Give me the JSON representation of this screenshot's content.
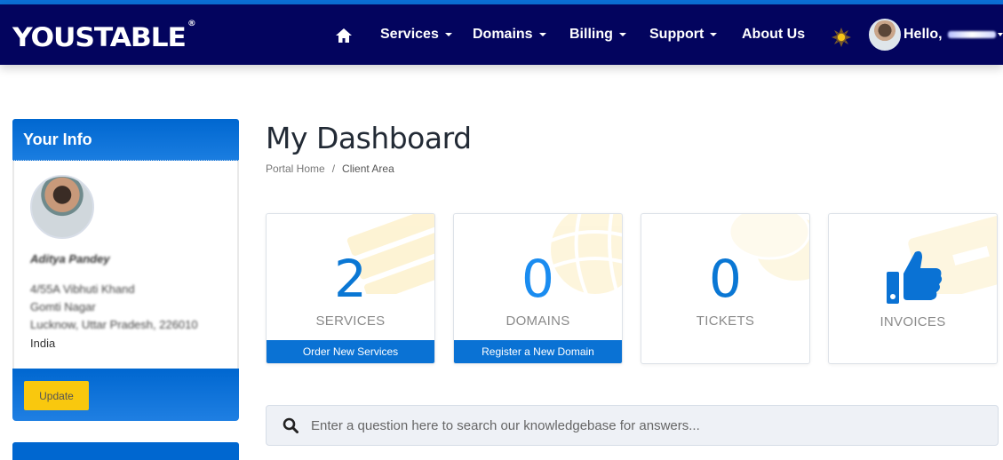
{
  "brand": {
    "logo_text": "YOUSTABLE",
    "logo_mark": "®"
  },
  "nav": {
    "items": [
      {
        "label": "Services",
        "has_dropdown": true
      },
      {
        "label": "Domains",
        "has_dropdown": true
      },
      {
        "label": "Billing",
        "has_dropdown": true
      },
      {
        "label": "Support",
        "has_dropdown": true
      },
      {
        "label": "About Us",
        "has_dropdown": false
      }
    ],
    "greeting": "Hello,",
    "icons": {
      "home": "home-icon",
      "theme": "sun-icon"
    }
  },
  "sidebar": {
    "title": "Your Info",
    "name": "Aditya Pandey",
    "address": [
      "4/55A Vibhuti Khand",
      "Gomti Nagar",
      "Lucknow, Uttar Pradesh, 226010",
      "India"
    ],
    "update_label": "Update"
  },
  "main": {
    "title": "My Dashboard",
    "breadcrumb": [
      "Portal Home",
      "Client Area"
    ],
    "breadcrumb_sep": "/",
    "tiles": [
      {
        "count": "2",
        "label": "SERVICES",
        "action": "Order New Services"
      },
      {
        "count": "0",
        "label": "DOMAINS",
        "action": "Register a New Domain"
      },
      {
        "count": "0",
        "label": "TICKETS"
      },
      {
        "label": "INVOICES",
        "icon": "thumbs-up-icon"
      }
    ],
    "search": {
      "placeholder": "Enter a question here to search our knowledgebase for answers..."
    }
  },
  "colors": {
    "navbar": "#03045e",
    "accent": "#0a72d4",
    "update_button": "#f9c80e"
  }
}
